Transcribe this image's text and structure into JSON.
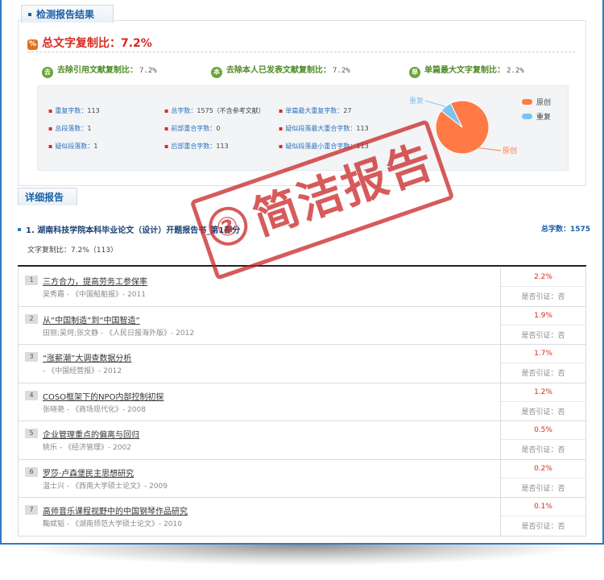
{
  "summary": {
    "tab_label": "检测报告结果",
    "total_label": "总文字复制比：",
    "total_value": "7.2%",
    "sub_stats": [
      {
        "icon": "去",
        "label": "去除引用文献复制比：",
        "value": "7.2%"
      },
      {
        "icon": "本",
        "label": "去除本人已发表文献复制比：",
        "value": "7.2%"
      },
      {
        "icon": "单",
        "label": "单篇最大文字复制比：",
        "value": "2.2%"
      }
    ],
    "stats": [
      {
        "label": "重复字数：",
        "value": "113"
      },
      {
        "label": "总字数：",
        "value": "1575（不含参考文献）"
      },
      {
        "label": "单篇最大重复字数：",
        "value": "27"
      },
      {
        "label": "总段落数：",
        "value": "1"
      },
      {
        "label": "前部重合字数：",
        "value": "0"
      },
      {
        "label": "疑似段落最大重合字数：",
        "value": "113"
      },
      {
        "label": "疑似段落数：",
        "value": "1"
      },
      {
        "label": "后部重合字数：",
        "value": "113"
      },
      {
        "label": "疑似段落最小重合字数：",
        "value": "113"
      }
    ],
    "bullet": "▪"
  },
  "chart_data": {
    "type": "pie",
    "slices": [
      {
        "name": "原创",
        "value": 92.8,
        "color": "#ff7a45"
      },
      {
        "name": "重复",
        "value": 7.2,
        "color": "#7ec3f0"
      }
    ],
    "legend": [
      "原创",
      "重复"
    ],
    "legend_position": "top-right"
  },
  "detail": {
    "tab_label": "详细报告",
    "doc_title": "1. 湖南科技学院本科毕业论文（设计）开题报告书_第1部分",
    "doc_total": "总字数：1575",
    "ratio_line": "文字复制比：7.2%（113）"
  },
  "references": [
    {
      "num": "1",
      "title": "三方合力，提高劳务工参保率",
      "meta": "吴秀霞 - 《中国船舶报》- 2011",
      "pct": "2.2%",
      "cite": "是否引证：否"
    },
    {
      "num": "2",
      "title": "从“中国制造”到“中国智造”",
      "meta": "田丽;吴珂;张文静 - 《人民日报海外版》- 2012",
      "pct": "1.9%",
      "cite": "是否引证：否"
    },
    {
      "num": "3",
      "title": "“涨薪潮”大调查数据分析",
      "meta": "- 《中国经营报》- 2012",
      "pct": "1.7%",
      "cite": "是否引证：否"
    },
    {
      "num": "4",
      "title": "COSO框架下的NPO内部控制初探",
      "meta": "张晓艳 - 《商场现代化》- 2008",
      "pct": "1.2%",
      "cite": "是否引证：否"
    },
    {
      "num": "5",
      "title": "企业管理重点的偏离与回归",
      "meta": "姚乐 - 《经济管理》- 2002",
      "pct": "0.5%",
      "cite": "是否引证：否"
    },
    {
      "num": "6",
      "title": "罗莎·卢森堡民主思想研究",
      "meta": "温士兴 - 《西南大学硕士论文》- 2009",
      "pct": "0.2%",
      "cite": "是否引证：否"
    },
    {
      "num": "7",
      "title": "高师音乐课程视野中的中国钢琴作品研究",
      "meta": "鞠斌韬 - 《湖南师范大学硕士论文》- 2010",
      "pct": "0.1%",
      "cite": "是否引证：否"
    }
  ],
  "stamp": {
    "circle": "②",
    "text": "简洁报告"
  },
  "colors": {
    "accent": "#2f7cc0",
    "danger": "#d62b1f",
    "green": "#6aa537",
    "stamp": "#c81c1c"
  }
}
